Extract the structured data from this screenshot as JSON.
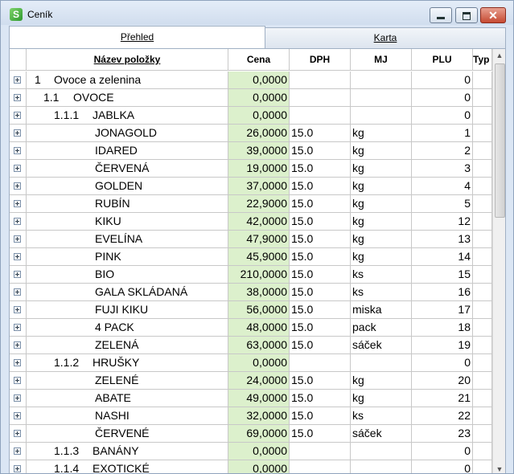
{
  "window": {
    "title": "Ceník"
  },
  "tabs": [
    {
      "label": "Přehled",
      "active": true
    },
    {
      "label": "Karta",
      "active": false
    }
  ],
  "columns": {
    "name": "Název položky",
    "price": "Cena",
    "dph": "DPH",
    "mj": "MJ",
    "plu": "PLU",
    "typ": "Typ"
  },
  "rows": [
    {
      "level": 0,
      "code": "1",
      "name": "Ovoce a zelenina",
      "price": "0,0000",
      "dph": "",
      "mj": "",
      "plu": "0"
    },
    {
      "level": 1,
      "code": "1.1",
      "name": "OVOCE",
      "price": "0,0000",
      "dph": "",
      "mj": "",
      "plu": "0"
    },
    {
      "level": 2,
      "code": "1.1.1",
      "name": "JABLKA",
      "price": "0,0000",
      "dph": "",
      "mj": "",
      "plu": "0"
    },
    {
      "level": 3,
      "code": "",
      "name": "JONAGOLD",
      "price": "26,0000",
      "dph": "15.0",
      "mj": "kg",
      "plu": "1"
    },
    {
      "level": 3,
      "code": "",
      "name": "IDARED",
      "price": "39,0000",
      "dph": "15.0",
      "mj": "kg",
      "plu": "2"
    },
    {
      "level": 3,
      "code": "",
      "name": "ČERVENÁ",
      "price": "19,0000",
      "dph": "15.0",
      "mj": "kg",
      "plu": "3"
    },
    {
      "level": 3,
      "code": "",
      "name": "GOLDEN",
      "price": "37,0000",
      "dph": "15.0",
      "mj": "kg",
      "plu": "4"
    },
    {
      "level": 3,
      "code": "",
      "name": "RUBÍN",
      "price": "22,9000",
      "dph": "15.0",
      "mj": "kg",
      "plu": "5"
    },
    {
      "level": 3,
      "code": "",
      "name": "KIKU",
      "price": "42,0000",
      "dph": "15.0",
      "mj": "kg",
      "plu": "12"
    },
    {
      "level": 3,
      "code": "",
      "name": "EVELÍNA",
      "price": "47,9000",
      "dph": "15.0",
      "mj": "kg",
      "plu": "13"
    },
    {
      "level": 3,
      "code": "",
      "name": "PINK",
      "price": "45,9000",
      "dph": "15.0",
      "mj": "kg",
      "plu": "14"
    },
    {
      "level": 3,
      "code": "",
      "name": "BIO",
      "price": "210,0000",
      "dph": "15.0",
      "mj": "ks",
      "plu": "15"
    },
    {
      "level": 3,
      "code": "",
      "name": "GALA SKLÁDANÁ",
      "price": "38,0000",
      "dph": "15.0",
      "mj": "ks",
      "plu": "16"
    },
    {
      "level": 3,
      "code": "",
      "name": "FUJI KIKU",
      "price": "56,0000",
      "dph": "15.0",
      "mj": "miska",
      "plu": "17"
    },
    {
      "level": 3,
      "code": "",
      "name": "4 PACK",
      "price": "48,0000",
      "dph": "15.0",
      "mj": "pack",
      "plu": "18"
    },
    {
      "level": 3,
      "code": "",
      "name": "ZELENÁ",
      "price": "63,0000",
      "dph": "15.0",
      "mj": "sáček",
      "plu": "19"
    },
    {
      "level": 2,
      "code": "1.1.2",
      "name": "HRUŠKY",
      "price": "0,0000",
      "dph": "",
      "mj": "",
      "plu": "0"
    },
    {
      "level": 3,
      "code": "",
      "name": "ZELENÉ",
      "price": "24,0000",
      "dph": "15.0",
      "mj": "kg",
      "plu": "20"
    },
    {
      "level": 3,
      "code": "",
      "name": "ABATE",
      "price": "49,0000",
      "dph": "15.0",
      "mj": "kg",
      "plu": "21"
    },
    {
      "level": 3,
      "code": "",
      "name": "NASHI",
      "price": "32,0000",
      "dph": "15.0",
      "mj": "ks",
      "plu": "22"
    },
    {
      "level": 3,
      "code": "",
      "name": "ČERVENÉ",
      "price": "69,0000",
      "dph": "15.0",
      "mj": "sáček",
      "plu": "23"
    },
    {
      "level": 2,
      "code": "1.1.3",
      "name": "BANÁNY",
      "price": "0,0000",
      "dph": "",
      "mj": "",
      "plu": "0"
    },
    {
      "level": 2,
      "code": "1.1.4",
      "name": "EXOTICKÉ",
      "price": "0,0000",
      "dph": "",
      "mj": "",
      "plu": "0"
    }
  ]
}
